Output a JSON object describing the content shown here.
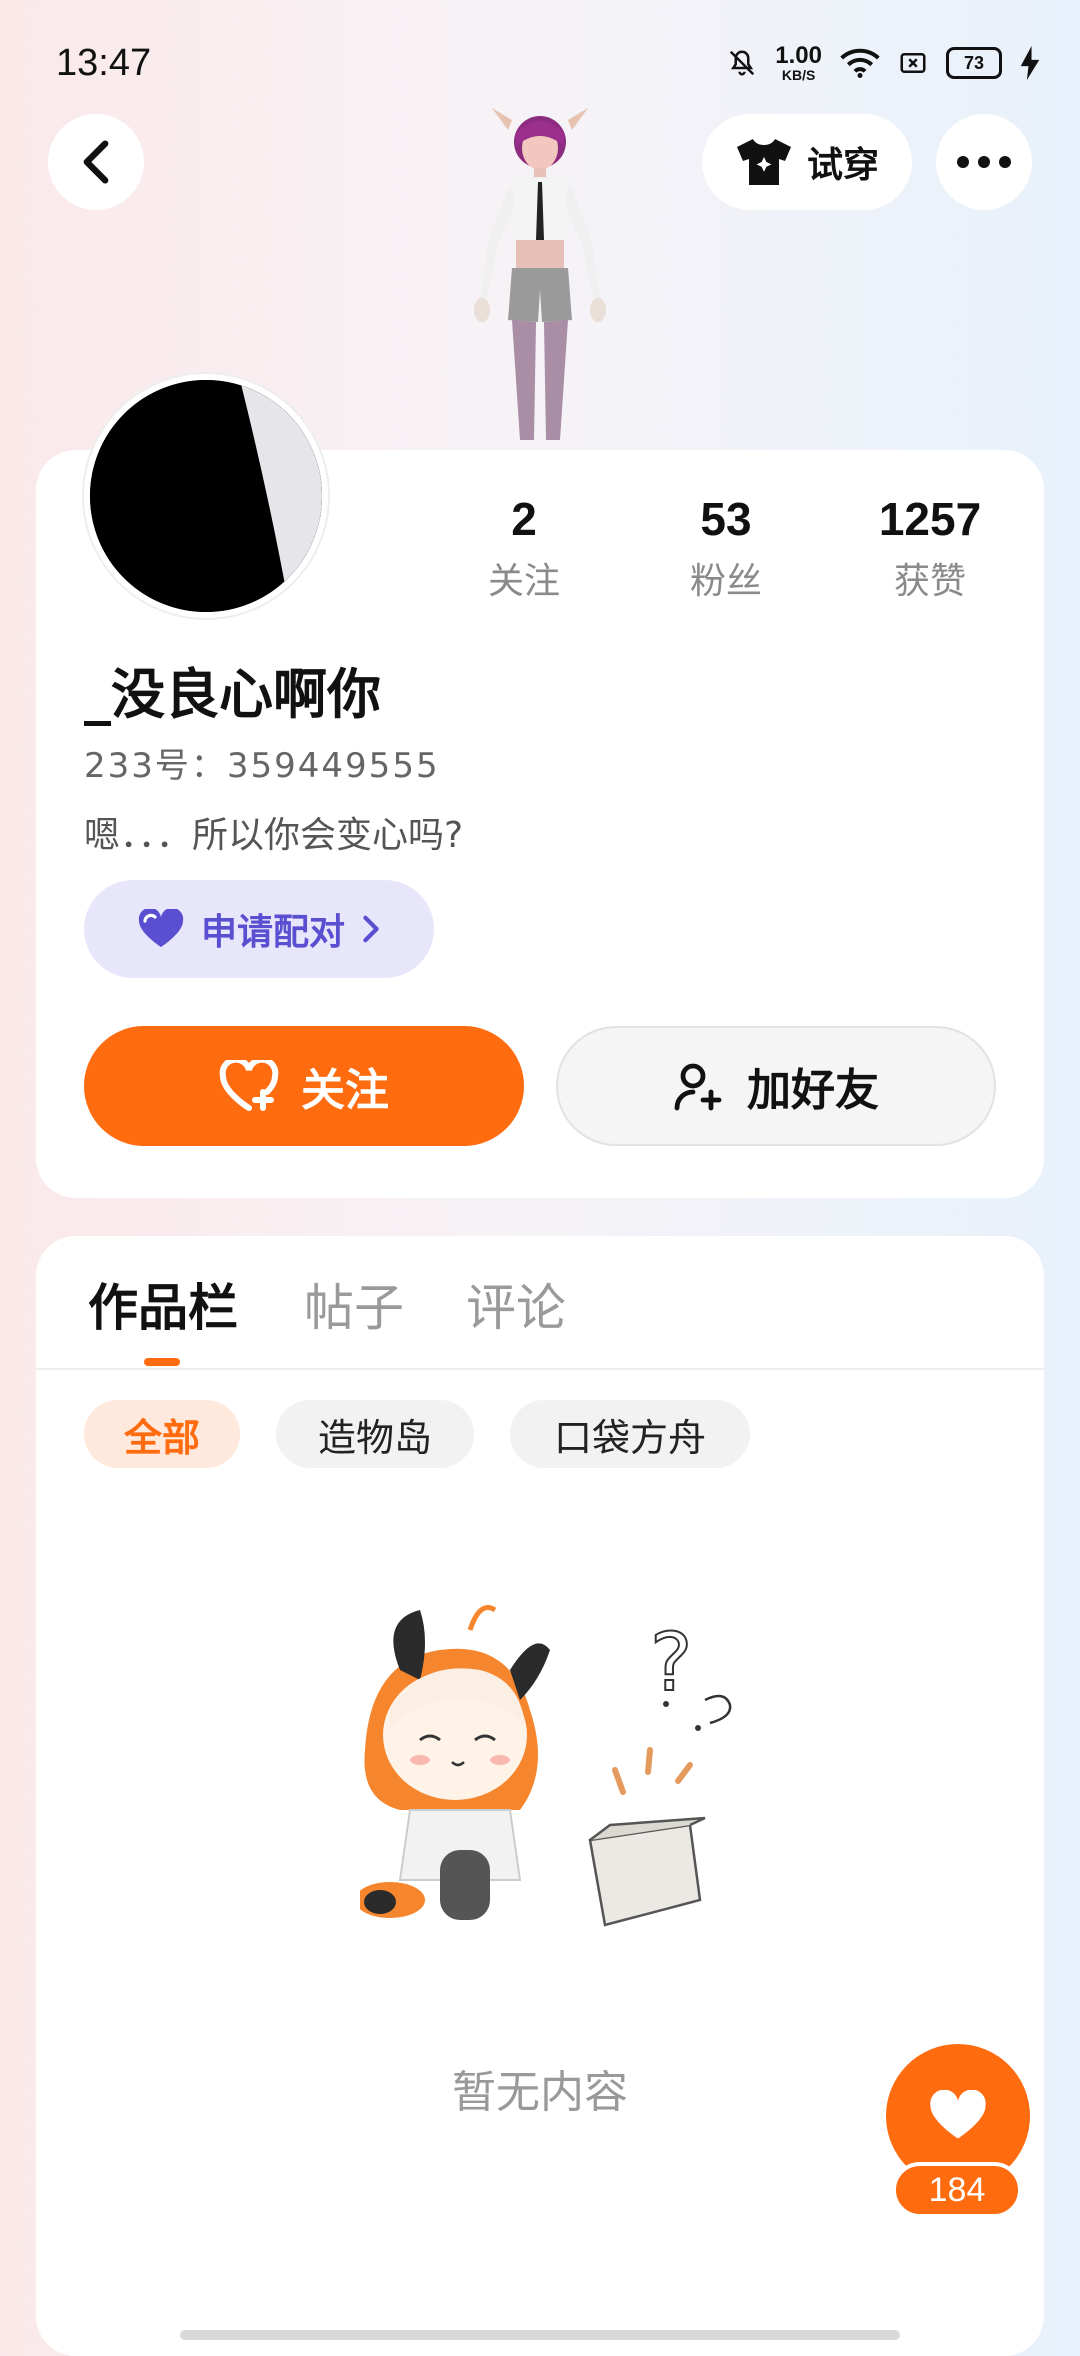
{
  "status_bar": {
    "time": "13:47",
    "net_speed_value": "1.00",
    "net_speed_unit": "KB/S",
    "battery": "73",
    "icons": [
      "bell-muted-icon",
      "wifi-icon",
      "sim-icon",
      "battery-icon",
      "charging-icon"
    ]
  },
  "header": {
    "try_on_label": "试穿",
    "icons": [
      "back-icon",
      "shirt-icon",
      "more-icon"
    ]
  },
  "profile": {
    "username": "_没良心啊你",
    "uid": "233号：359449555",
    "bio": "嗯．．．所以你会变心吗?",
    "pair_label": "申请配对",
    "stats": [
      {
        "value": "2",
        "label": "关注"
      },
      {
        "value": "53",
        "label": "粉丝"
      },
      {
        "value": "1257",
        "label": "获赞"
      }
    ],
    "follow_label": "关注",
    "add_friend_label": "加好友"
  },
  "tabs": {
    "items": [
      "作品栏",
      "帖子",
      "评论"
    ],
    "active": 0
  },
  "filters": {
    "items": [
      "全部",
      "造物岛",
      "口袋方舟"
    ],
    "active": 0
  },
  "empty_state": {
    "text": "暂无内容"
  },
  "like_fab": {
    "count": "184"
  },
  "colors": {
    "accent": "#ff6b0f",
    "pair_bg": "#e8e6fb",
    "pair_text": "#5b4fd1"
  }
}
